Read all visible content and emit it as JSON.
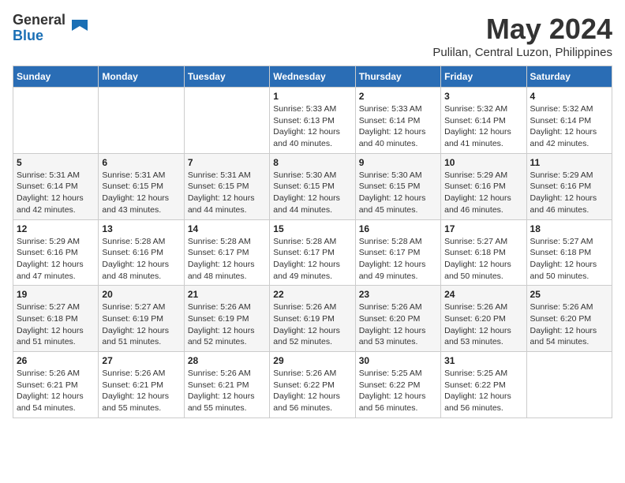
{
  "logo": {
    "general": "General",
    "blue": "Blue"
  },
  "title": "May 2024",
  "location": "Pulilan, Central Luzon, Philippines",
  "days_header": [
    "Sunday",
    "Monday",
    "Tuesday",
    "Wednesday",
    "Thursday",
    "Friday",
    "Saturday"
  ],
  "weeks": [
    [
      {
        "day": "",
        "info": ""
      },
      {
        "day": "",
        "info": ""
      },
      {
        "day": "",
        "info": ""
      },
      {
        "day": "1",
        "info": "Sunrise: 5:33 AM\nSunset: 6:13 PM\nDaylight: 12 hours\nand 40 minutes."
      },
      {
        "day": "2",
        "info": "Sunrise: 5:33 AM\nSunset: 6:14 PM\nDaylight: 12 hours\nand 40 minutes."
      },
      {
        "day": "3",
        "info": "Sunrise: 5:32 AM\nSunset: 6:14 PM\nDaylight: 12 hours\nand 41 minutes."
      },
      {
        "day": "4",
        "info": "Sunrise: 5:32 AM\nSunset: 6:14 PM\nDaylight: 12 hours\nand 42 minutes."
      }
    ],
    [
      {
        "day": "5",
        "info": "Sunrise: 5:31 AM\nSunset: 6:14 PM\nDaylight: 12 hours\nand 42 minutes."
      },
      {
        "day": "6",
        "info": "Sunrise: 5:31 AM\nSunset: 6:15 PM\nDaylight: 12 hours\nand 43 minutes."
      },
      {
        "day": "7",
        "info": "Sunrise: 5:31 AM\nSunset: 6:15 PM\nDaylight: 12 hours\nand 44 minutes."
      },
      {
        "day": "8",
        "info": "Sunrise: 5:30 AM\nSunset: 6:15 PM\nDaylight: 12 hours\nand 44 minutes."
      },
      {
        "day": "9",
        "info": "Sunrise: 5:30 AM\nSunset: 6:15 PM\nDaylight: 12 hours\nand 45 minutes."
      },
      {
        "day": "10",
        "info": "Sunrise: 5:29 AM\nSunset: 6:16 PM\nDaylight: 12 hours\nand 46 minutes."
      },
      {
        "day": "11",
        "info": "Sunrise: 5:29 AM\nSunset: 6:16 PM\nDaylight: 12 hours\nand 46 minutes."
      }
    ],
    [
      {
        "day": "12",
        "info": "Sunrise: 5:29 AM\nSunset: 6:16 PM\nDaylight: 12 hours\nand 47 minutes."
      },
      {
        "day": "13",
        "info": "Sunrise: 5:28 AM\nSunset: 6:16 PM\nDaylight: 12 hours\nand 48 minutes."
      },
      {
        "day": "14",
        "info": "Sunrise: 5:28 AM\nSunset: 6:17 PM\nDaylight: 12 hours\nand 48 minutes."
      },
      {
        "day": "15",
        "info": "Sunrise: 5:28 AM\nSunset: 6:17 PM\nDaylight: 12 hours\nand 49 minutes."
      },
      {
        "day": "16",
        "info": "Sunrise: 5:28 AM\nSunset: 6:17 PM\nDaylight: 12 hours\nand 49 minutes."
      },
      {
        "day": "17",
        "info": "Sunrise: 5:27 AM\nSunset: 6:18 PM\nDaylight: 12 hours\nand 50 minutes."
      },
      {
        "day": "18",
        "info": "Sunrise: 5:27 AM\nSunset: 6:18 PM\nDaylight: 12 hours\nand 50 minutes."
      }
    ],
    [
      {
        "day": "19",
        "info": "Sunrise: 5:27 AM\nSunset: 6:18 PM\nDaylight: 12 hours\nand 51 minutes."
      },
      {
        "day": "20",
        "info": "Sunrise: 5:27 AM\nSunset: 6:19 PM\nDaylight: 12 hours\nand 51 minutes."
      },
      {
        "day": "21",
        "info": "Sunrise: 5:26 AM\nSunset: 6:19 PM\nDaylight: 12 hours\nand 52 minutes."
      },
      {
        "day": "22",
        "info": "Sunrise: 5:26 AM\nSunset: 6:19 PM\nDaylight: 12 hours\nand 52 minutes."
      },
      {
        "day": "23",
        "info": "Sunrise: 5:26 AM\nSunset: 6:20 PM\nDaylight: 12 hours\nand 53 minutes."
      },
      {
        "day": "24",
        "info": "Sunrise: 5:26 AM\nSunset: 6:20 PM\nDaylight: 12 hours\nand 53 minutes."
      },
      {
        "day": "25",
        "info": "Sunrise: 5:26 AM\nSunset: 6:20 PM\nDaylight: 12 hours\nand 54 minutes."
      }
    ],
    [
      {
        "day": "26",
        "info": "Sunrise: 5:26 AM\nSunset: 6:21 PM\nDaylight: 12 hours\nand 54 minutes."
      },
      {
        "day": "27",
        "info": "Sunrise: 5:26 AM\nSunset: 6:21 PM\nDaylight: 12 hours\nand 55 minutes."
      },
      {
        "day": "28",
        "info": "Sunrise: 5:26 AM\nSunset: 6:21 PM\nDaylight: 12 hours\nand 55 minutes."
      },
      {
        "day": "29",
        "info": "Sunrise: 5:26 AM\nSunset: 6:22 PM\nDaylight: 12 hours\nand 56 minutes."
      },
      {
        "day": "30",
        "info": "Sunrise: 5:25 AM\nSunset: 6:22 PM\nDaylight: 12 hours\nand 56 minutes."
      },
      {
        "day": "31",
        "info": "Sunrise: 5:25 AM\nSunset: 6:22 PM\nDaylight: 12 hours\nand 56 minutes."
      },
      {
        "day": "",
        "info": ""
      }
    ]
  ]
}
